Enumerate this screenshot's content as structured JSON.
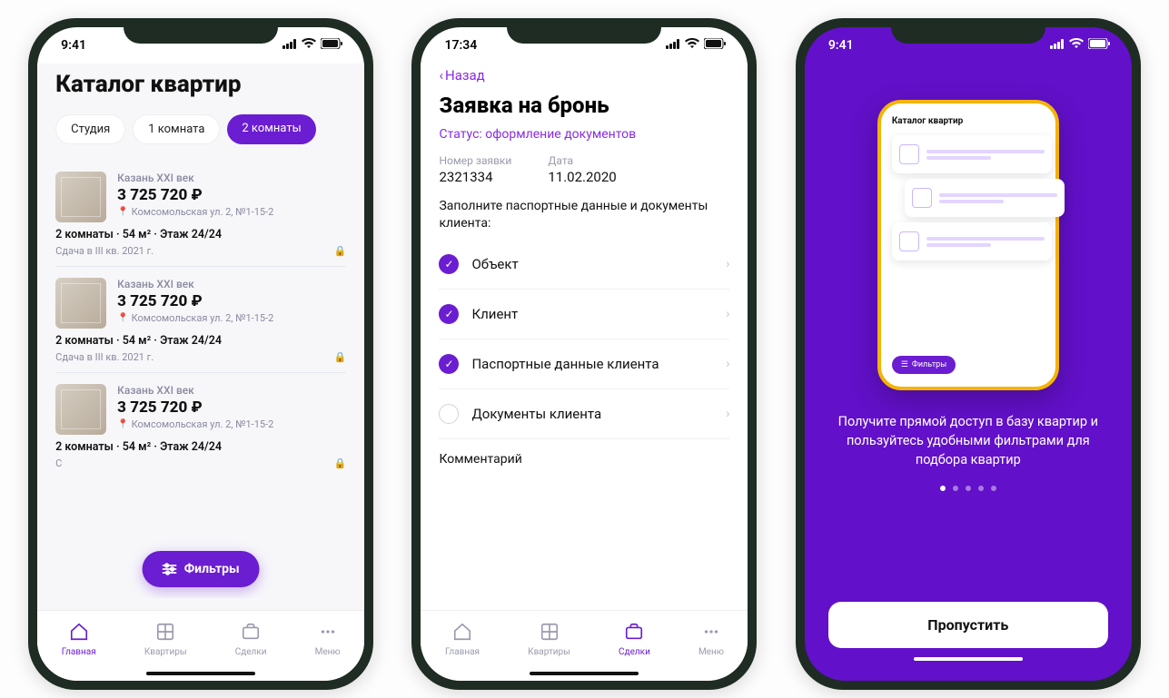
{
  "phone1": {
    "status_time": "9:41",
    "title": "Каталог квартир",
    "chips": [
      {
        "label": "Студия",
        "active": false
      },
      {
        "label": "1 комната",
        "active": false
      },
      {
        "label": "2 комнаты",
        "active": true
      }
    ],
    "listings": [
      {
        "project": "Казань XXI век",
        "price": "3 725 720 ₽",
        "address": "Комсомольская ул. 2, №1-15-2",
        "meta": "2 комнаты · 54 м² · Этаж 24/24",
        "due": "Сдача в III кв. 2021 г."
      },
      {
        "project": "Казань XXI век",
        "price": "3 725 720 ₽",
        "address": "Комсомольская ул. 2, №1-15-2",
        "meta": "2 комнаты · 54 м² · Этаж 24/24",
        "due": "Сдача в III кв. 2021 г."
      },
      {
        "project": "Казань XXI век",
        "price": "3 725 720 ₽",
        "address": "Комсомольская ул. 2, №1-15-2",
        "meta": "2 комнаты · 54 м² · Этаж 24/24",
        "due": "С"
      }
    ],
    "filters_label": "Фильтры",
    "tabs": [
      {
        "label": "Главная",
        "icon": "home",
        "active": true
      },
      {
        "label": "Квартиры",
        "icon": "grid",
        "active": false
      },
      {
        "label": "Сделки",
        "icon": "case",
        "active": false
      },
      {
        "label": "Меню",
        "icon": "dots",
        "active": false
      }
    ]
  },
  "phone2": {
    "status_time": "17:34",
    "back_label": "Назад",
    "title": "Заявка на бронь",
    "status_text": "Статус: оформление документов",
    "req_num_label": "Номер заявки",
    "req_num_value": "2321334",
    "date_label": "Дата",
    "date_value": "11.02.2020",
    "instruction": "Заполните паспортные данные и документы клиента:",
    "steps": [
      {
        "label": "Объект",
        "done": true
      },
      {
        "label": "Клиент",
        "done": true
      },
      {
        "label": "Паспортные данные клиента",
        "done": true
      },
      {
        "label": "Документы клиента",
        "done": false
      }
    ],
    "comment_label": "Комментарий",
    "tabs": [
      {
        "label": "Главная",
        "icon": "home",
        "active": false
      },
      {
        "label": "Квартиры",
        "icon": "grid",
        "active": false
      },
      {
        "label": "Сделки",
        "icon": "case",
        "active": true
      },
      {
        "label": "Меню",
        "icon": "dots",
        "active": false
      }
    ]
  },
  "phone3": {
    "status_time": "9:41",
    "mock_title": "Каталог квартир",
    "mock_filter_label": "Фильтры",
    "body_text": "Получите прямой доступ в базу квартир и пользуйтесь удобными фильтрами для подбора квартир",
    "dots_total": 5,
    "dots_active_index": 0,
    "skip_label": "Пропустить"
  }
}
